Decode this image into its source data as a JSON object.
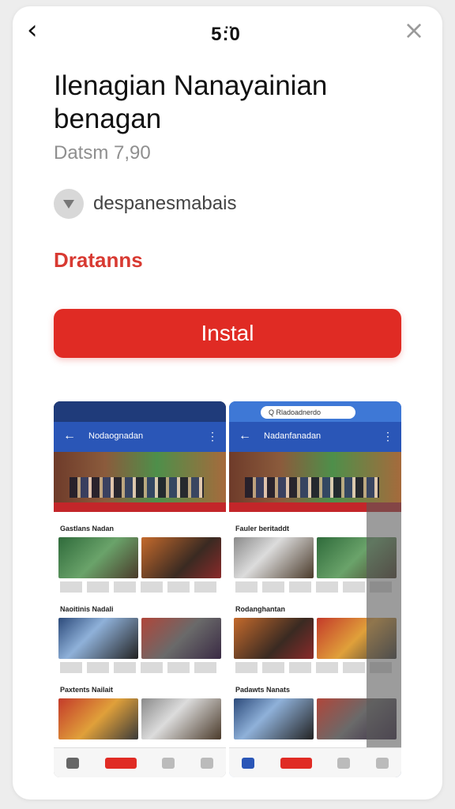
{
  "status_bar": {
    "time": "5:̈0"
  },
  "topbar": {
    "back_icon": "chevron-left-icon",
    "close_icon": "close-icon"
  },
  "app": {
    "title": "Ilenagian Nanayainian benagan",
    "subtitle": "Datsm 7,90",
    "developer": "despanesmabais",
    "accent_label": "Dratanns",
    "install_label": "Instal"
  },
  "colors": {
    "accent": "#e02b24",
    "appbar_blue": "#2a56b7",
    "text": "#111111"
  },
  "screenshots": [
    {
      "appbar_title": "Nodaognadan",
      "sections": [
        "Gastlans Nadan",
        "Naoitinis Nadali",
        "Paxtents Nailait"
      ],
      "nav_icons": [
        "home-icon",
        "video-icon",
        "tv-icon",
        "profile-icon"
      ]
    },
    {
      "url": "Q Rladoadnerdo",
      "appbar_title": "Nadanfanadan",
      "sections": [
        "Fauler beritaddt",
        "Rodanghantan",
        "Padawts Nanats"
      ],
      "nav_icons": [
        "home-icon",
        "live-icon",
        "play-icon",
        "search-icon"
      ]
    }
  ]
}
